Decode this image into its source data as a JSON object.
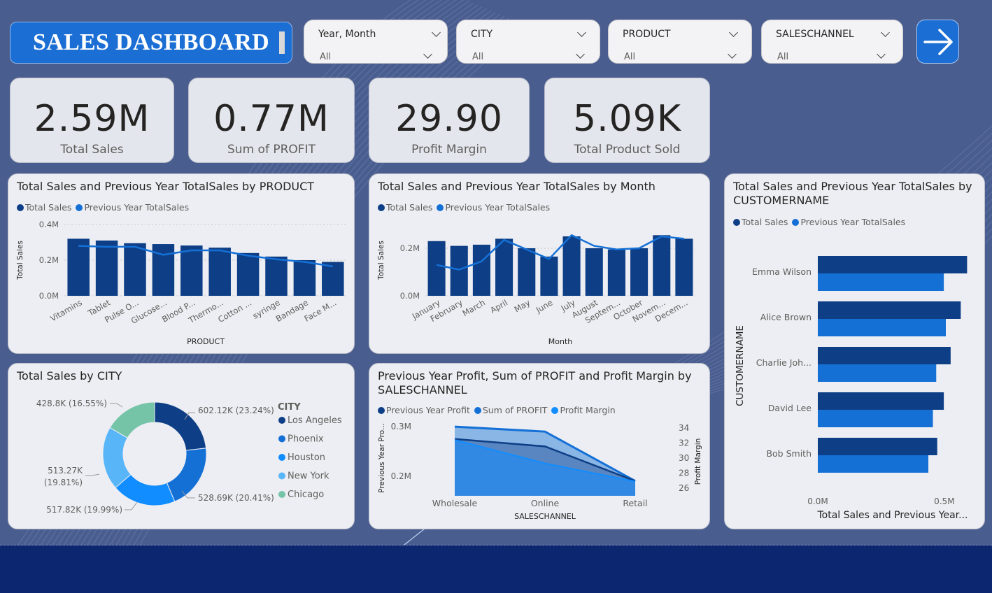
{
  "header": {
    "title": "SALES DASHBOARD"
  },
  "slicers": [
    {
      "label": "Year, Month",
      "value": "All"
    },
    {
      "label": "CITY",
      "value": "All"
    },
    {
      "label": "PRODUCT",
      "value": "All"
    },
    {
      "label": "SALESCHANNEL",
      "value": "All"
    }
  ],
  "kpis": [
    {
      "value": "2.59M",
      "label": "Total Sales"
    },
    {
      "value": "0.77M",
      "label": "Sum of PROFIT"
    },
    {
      "value": "29.90",
      "label": "Profit Margin"
    },
    {
      "value": "5.09K",
      "label": "Total Product Sold"
    }
  ],
  "colors": {
    "dark_blue": "#0e3f86",
    "mid_blue": "#1570d6",
    "bright_blue": "#118dff",
    "light_blue": "#58b5f8",
    "teal": "#75c4a8"
  },
  "chart_data": [
    {
      "type": "bar",
      "title": "Total Sales and Previous Year TotalSales by PRODUCT",
      "xlabel": "PRODUCT",
      "ylabel": "Total Sales",
      "yticks": [
        "0.4M",
        "0.2M",
        "0.0M"
      ],
      "ylim": [
        0,
        0.4
      ],
      "categories": [
        "Vitamins",
        "Tablet",
        "Pulse O...",
        "Glucose...",
        "Blood P...",
        "Thermo...",
        "Cotton ...",
        "syringe",
        "Bandage",
        "Face M..."
      ],
      "series": [
        {
          "name": "Total Sales",
          "kind": "bar",
          "values": [
            0.32,
            0.31,
            0.295,
            0.29,
            0.282,
            0.27,
            0.24,
            0.22,
            0.2,
            0.19
          ]
        },
        {
          "name": "Previous Year TotalSales",
          "kind": "line",
          "values": [
            0.28,
            0.275,
            0.275,
            0.23,
            0.255,
            0.255,
            0.225,
            0.205,
            0.19,
            0.165
          ]
        }
      ]
    },
    {
      "type": "bar",
      "title": "Total Sales and Previous Year TotalSales by Month",
      "xlabel": "Month",
      "ylabel": "Total Sales",
      "yticks": [
        "0.2M",
        "0.0M"
      ],
      "ylim": [
        0,
        0.3
      ],
      "categories": [
        "January",
        "February",
        "March",
        "April",
        "May",
        "June",
        "July",
        "August",
        "Septem...",
        "October",
        "Novem...",
        "Decem..."
      ],
      "series": [
        {
          "name": "Total Sales",
          "kind": "bar",
          "values": [
            0.23,
            0.21,
            0.215,
            0.24,
            0.2,
            0.165,
            0.25,
            0.2,
            0.195,
            0.2,
            0.255,
            0.24
          ]
        },
        {
          "name": "Previous Year TotalSales",
          "kind": "line",
          "values": [
            0.13,
            0.11,
            0.145,
            0.235,
            0.195,
            0.155,
            0.255,
            0.21,
            0.195,
            0.2,
            0.25,
            0.24
          ]
        }
      ]
    },
    {
      "type": "bar",
      "title": "Total Sales and Previous Year TotalSales by CUSTOMERNAME",
      "orientation": "horizontal",
      "ylabel": "CUSTOMERNAME",
      "xlabel": "Total Sales and Previous Year...",
      "xticks": [
        "0.0M",
        "0.5M"
      ],
      "xlim": [
        0,
        0.6
      ],
      "categories": [
        "Emma Wilson",
        "Alice Brown",
        "Charlie Joh...",
        "David Lee",
        "Bob Smith"
      ],
      "series": [
        {
          "name": "Total Sales",
          "values": [
            0.59,
            0.565,
            0.525,
            0.498,
            0.472
          ]
        },
        {
          "name": "Previous Year TotalSales",
          "values": [
            0.498,
            0.506,
            0.468,
            0.455,
            0.437
          ]
        }
      ]
    },
    {
      "type": "pie",
      "title": "Total Sales by CITY",
      "legend_title": "CITY",
      "slices": [
        {
          "name": "Los Angeles",
          "value": 602.12,
          "label": "602.12K (23.24%)",
          "pct": 23.24
        },
        {
          "name": "Phoenix",
          "value": 528.69,
          "label": "528.69K (20.41%)",
          "pct": 20.41
        },
        {
          "name": "Houston",
          "value": 517.82,
          "label": "517.82K (19.99%)",
          "pct": 19.99
        },
        {
          "name": "New York",
          "value": 513.27,
          "label_line1": "513.27K",
          "label_line2": "(19.81%)",
          "pct": 19.81
        },
        {
          "name": "Chicago",
          "value": 428.8,
          "label": "428.8K (16.55%)",
          "pct": 16.55
        }
      ]
    },
    {
      "type": "area",
      "title": "Previous Year Profit, Sum of PROFIT and Profit Margin by SALESCHANNEL",
      "xlabel": "SALESCHANNEL",
      "ylabel": "Previous Year Pro...",
      "ylabel_right": "Profit Margin",
      "categories": [
        "Wholesale",
        "Online",
        "Retail"
      ],
      "yticks": [
        "0.3M",
        "0.2M"
      ],
      "ylim": [
        0.16,
        0.32
      ],
      "yticks_right": [
        "34",
        "32",
        "30",
        "28",
        "26"
      ],
      "ylim_right": [
        25,
        35
      ],
      "series": [
        {
          "name": "Previous Year Profit",
          "values": [
            0.275,
            0.26,
            0.19
          ]
        },
        {
          "name": "Sum of PROFIT",
          "values": [
            0.3,
            0.29,
            0.19
          ]
        },
        {
          "name": "Profit Margin",
          "axis": "right",
          "values": [
            32.4,
            29.3,
            26.9
          ]
        }
      ]
    }
  ]
}
